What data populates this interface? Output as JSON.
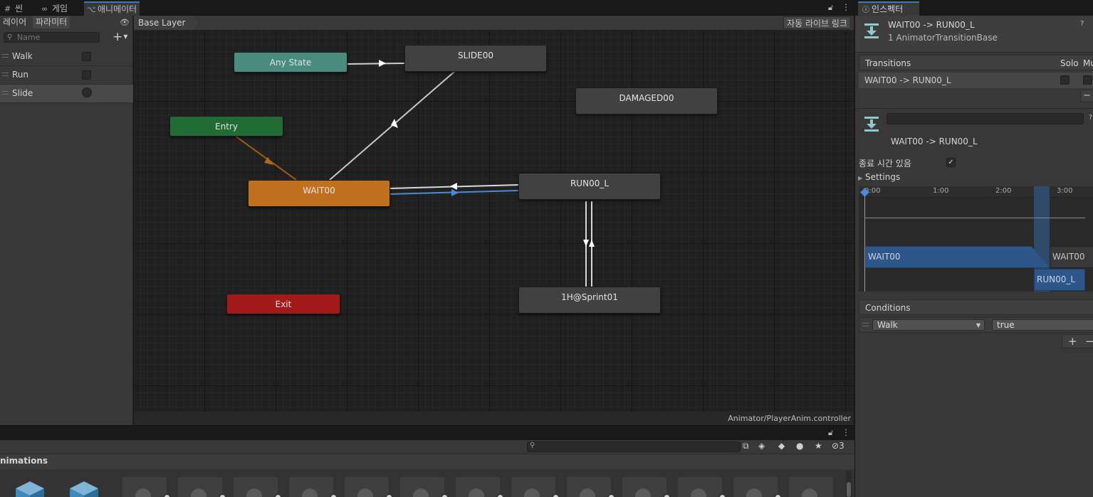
{
  "tabs": {
    "scene": "씬",
    "game": "게임",
    "animator": "애니메이터"
  },
  "left_panel": {
    "tab_layers": "레이어",
    "tab_params": "파라미터",
    "search_placeholder": "Name",
    "params": [
      {
        "name": "Walk",
        "type": "bool"
      },
      {
        "name": "Run",
        "type": "bool"
      },
      {
        "name": "Slide",
        "type": "trigger"
      }
    ]
  },
  "graph": {
    "breadcrumb": "Base Layer",
    "live_link": "자동 라이브 링크",
    "controller_path": "Animator/PlayerAnim.controller",
    "nodes": {
      "any_state": "Any State",
      "entry": "Entry",
      "exit": "Exit",
      "wait00": "WAIT00",
      "slide00": "SLIDE00",
      "damaged00": "DAMAGED00",
      "run00_l": "RUN00_L",
      "sprint": "1H@Sprint01"
    }
  },
  "project": {
    "title": "nimations",
    "hidden_count": "3"
  },
  "inspector": {
    "tab": "인스펙터",
    "title": "WAIT00 -> RUN00_L",
    "subtitle": "1 AnimatorTransitionBase",
    "transitions_header": "Transitions",
    "solo_label": "Solo",
    "mute_label": "Mu",
    "transition_item": "WAIT00 -> RUN00_L",
    "transition_name": "WAIT00 -> RUN00_L",
    "has_exit_time": "종료 시간 있음",
    "settings": "Settings",
    "timeline": {
      "ticks": [
        "0:00",
        "1:00",
        "2:00",
        "3:00"
      ],
      "source_clip": "WAIT00",
      "source_clip_after": "WAIT00",
      "dest_clip": "RUN00_L"
    },
    "conditions_header": "Conditions",
    "condition": {
      "param": "Walk",
      "value": "true"
    },
    "minus": "−",
    "plus": "+"
  }
}
